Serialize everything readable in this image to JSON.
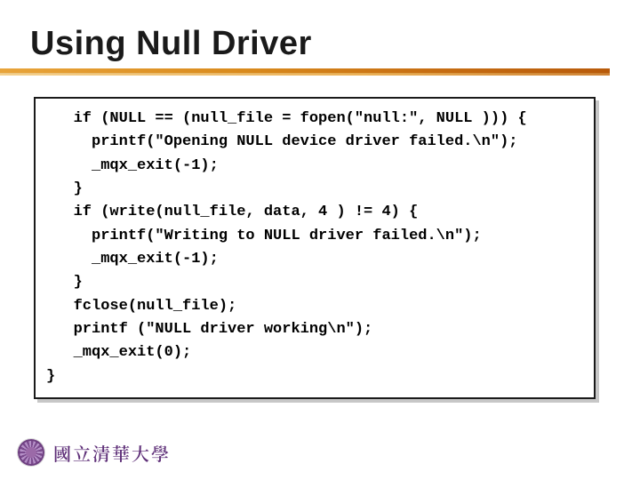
{
  "title": "Using Null Driver",
  "code": "   if (NULL == (null_file = fopen(\"null:\", NULL ))) {\n     printf(\"Opening NULL device driver failed.\\n\");\n     _mqx_exit(-1);\n   }\n   if (write(null_file, data, 4 ) != 4) {\n     printf(\"Writing to NULL driver failed.\\n\");\n     _mqx_exit(-1);\n   }\n   fclose(null_file);\n   printf (\"NULL driver working\\n\");\n   _mqx_exit(0);\n}",
  "footer": {
    "university": "國立清華大學"
  }
}
